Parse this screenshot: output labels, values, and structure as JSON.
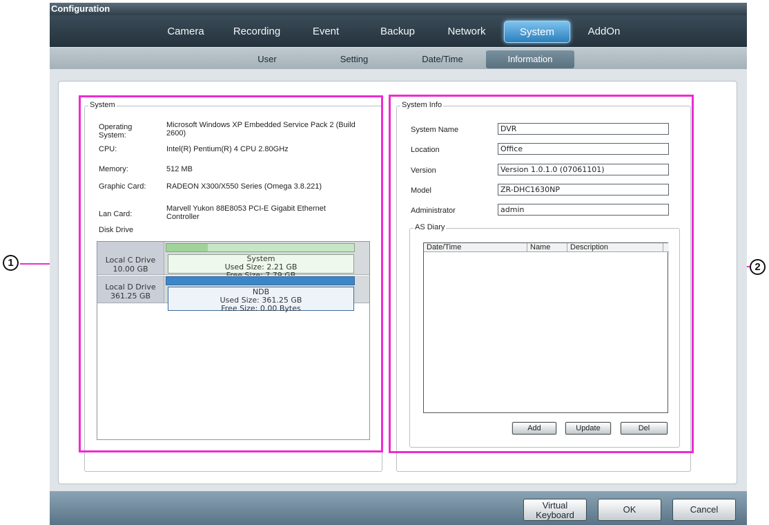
{
  "window": {
    "title": "Configuration"
  },
  "main_tabs": [
    {
      "label": "Camera"
    },
    {
      "label": "Recording"
    },
    {
      "label": "Event"
    },
    {
      "label": "Backup"
    },
    {
      "label": "Network"
    },
    {
      "label": "System"
    },
    {
      "label": "AddOn"
    }
  ],
  "active_main_tab": "System",
  "sub_tabs": [
    {
      "label": "User"
    },
    {
      "label": "Setting"
    },
    {
      "label": "Date/Time"
    },
    {
      "label": "Information"
    }
  ],
  "active_sub_tab": "Information",
  "system": {
    "legend": "System",
    "os_label": "Operating System:",
    "os_value": "Microsoft Windows XP Embedded Service Pack 2 (Build 2600)",
    "cpu_label": "CPU:",
    "cpu_value": "Intel(R) Pentium(R) 4 CPU 2.80GHz",
    "memory_label": "Memory:",
    "memory_value": "512 MB",
    "graphic_label": "Graphic Card:",
    "graphic_value": "RADEON X300/X550 Series (Omega 3.8.221)",
    "lan_label": "Lan Card:",
    "lan_value": "Marvell Yukon 88E8053 PCI-E Gigabit Ethernet Controller",
    "disk_label": "Disk Drive",
    "drives": [
      {
        "name": "Local C Drive",
        "size": "10.00 GB",
        "volume": "System",
        "used": "Used Size: 2.21 GB",
        "free": "Free Size: 7.79 GB",
        "used_fraction": 0.221,
        "color": "#9fd39a"
      },
      {
        "name": "Local D Drive",
        "size": "361.25 GB",
        "volume": "NDB",
        "used": "Used Size: 361.25 GB",
        "free": "Free Size: 0.00 Bytes",
        "used_fraction": 1.0,
        "color": "#3a86c8"
      }
    ]
  },
  "system_info": {
    "legend": "System Info",
    "fields": [
      {
        "label": "System Name",
        "value": "DVR"
      },
      {
        "label": "Location",
        "value": "Office"
      },
      {
        "label": "Version",
        "value": "Version 1.0.1.0 (07061101)"
      },
      {
        "label": "Model",
        "value": "ZR-DHC1630NP"
      },
      {
        "label": "Administrator",
        "value": "admin"
      }
    ],
    "as_diary": {
      "legend": "AS Diary",
      "columns": [
        "Date/Time",
        "Name",
        "Description"
      ],
      "buttons": {
        "add": "Add",
        "update": "Update",
        "del": "Del"
      }
    }
  },
  "bottom_buttons": {
    "virtual_keyboard_line1": "Virtual",
    "virtual_keyboard_line2": "Keyboard",
    "ok": "OK",
    "cancel": "Cancel"
  },
  "callouts": [
    "1",
    "2"
  ],
  "colors": {
    "highlight": "#ee2bd2",
    "active_tab": "#2c7fbc"
  }
}
